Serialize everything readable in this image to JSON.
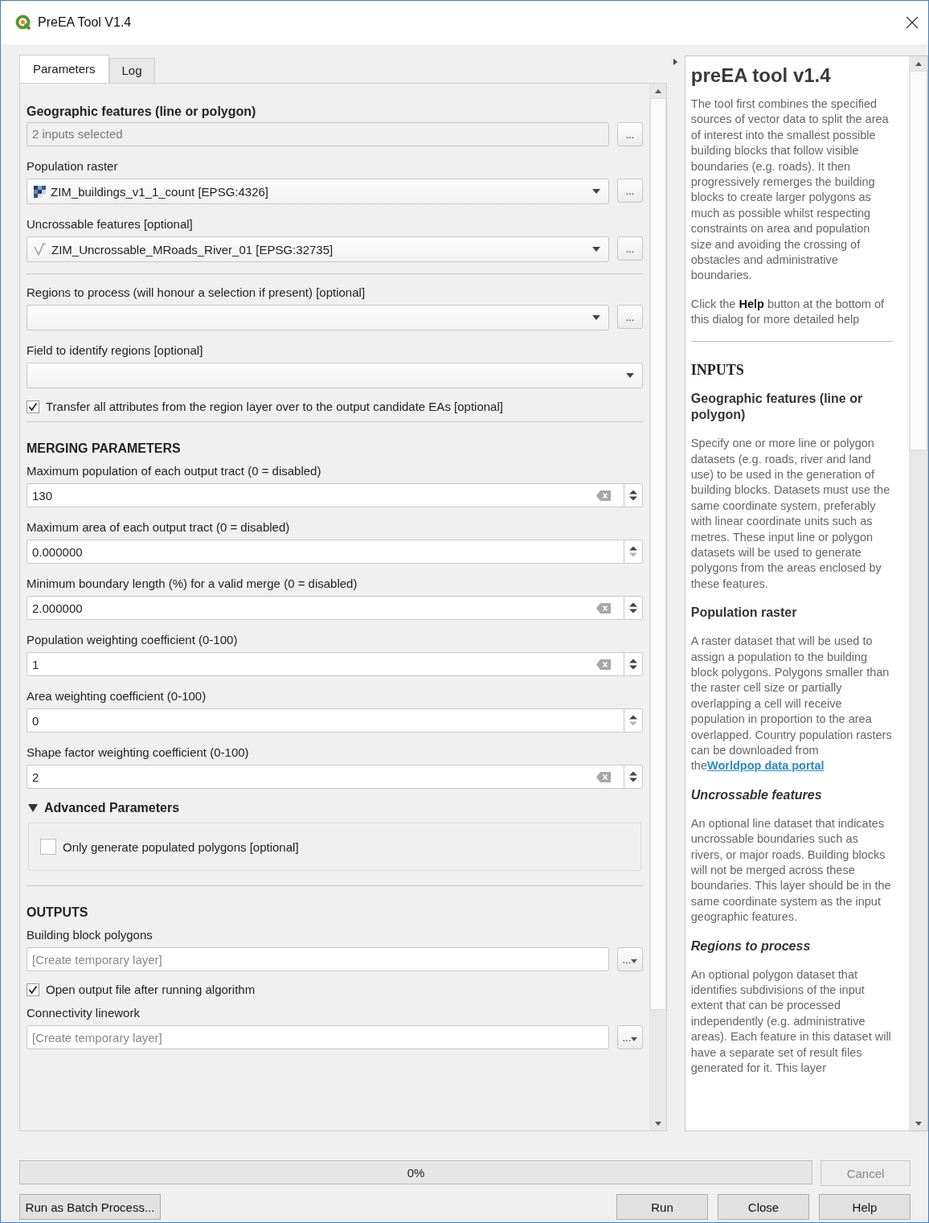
{
  "window": {
    "title": "PreEA Tool V1.4"
  },
  "tabs": [
    {
      "label": "Parameters",
      "selected": true
    },
    {
      "label": "Log",
      "selected": false
    }
  ],
  "parameters": [
    {
      "kind": "heading",
      "text": "Geographic features (line or polygon)"
    },
    {
      "kind": "multi",
      "value": "2 inputs selected",
      "button": "..."
    },
    {
      "kind": "label",
      "text": "Population raster"
    },
    {
      "kind": "raster_combo",
      "value": "ZIM_buildings_v1_1_count [EPSG:4326]",
      "button": "..."
    },
    {
      "kind": "label",
      "text": "Uncrossable features [optional]"
    },
    {
      "kind": "line_combo",
      "value": "ZIM_Uncrossable_MRoads_River_01 [EPSG:32735]",
      "button": "..."
    },
    {
      "kind": "divider"
    },
    {
      "kind": "label",
      "text": "Regions to process (will honour a selection if present) [optional]"
    },
    {
      "kind": "combo",
      "button": "..."
    },
    {
      "kind": "label",
      "text": "Field to identify regions [optional]"
    },
    {
      "kind": "combo"
    },
    {
      "kind": "checkbox",
      "text": "Transfer all attributes from the region layer over to the output candidate EAs [optional]",
      "checked": true
    },
    {
      "kind": "divider"
    },
    {
      "kind": "section",
      "text": "MERGING PARAMETERS"
    },
    {
      "kind": "label",
      "text": "Maximum population of each output tract (0 = disabled)"
    },
    {
      "kind": "spin",
      "value": "130",
      "clear": true,
      "down_enabled": true
    },
    {
      "kind": "label",
      "text": "Maximum area of each output tract (0 = disabled)"
    },
    {
      "kind": "spin",
      "value": "0.000000",
      "clear": false,
      "down_enabled": false
    },
    {
      "kind": "label",
      "text": "Minimum boundary length (%) for a valid merge (0 = disabled)"
    },
    {
      "kind": "spin",
      "value": "2.000000",
      "clear": true,
      "down_enabled": true
    },
    {
      "kind": "label",
      "text": "Population weighting coefficient (0-100)"
    },
    {
      "kind": "spin",
      "value": "1",
      "clear": true,
      "down_enabled": true
    },
    {
      "kind": "label",
      "text": "Area weighting coefficient (0-100)"
    },
    {
      "kind": "spin",
      "value": "0",
      "clear": false,
      "down_enabled": false
    },
    {
      "kind": "label",
      "text": "Shape factor weighting coefficient (0-100)"
    },
    {
      "kind": "spin",
      "value": "2",
      "clear": true,
      "down_enabled": true
    },
    {
      "kind": "group",
      "title": "Advanced Parameters",
      "expanded": true,
      "children": [
        {
          "kind": "checkbox",
          "text": "Only generate populated polygons [optional]",
          "checked": false
        }
      ]
    },
    {
      "kind": "divider"
    },
    {
      "kind": "section",
      "text": "OUTPUTS"
    },
    {
      "kind": "label",
      "text": "Building block polygons"
    },
    {
      "kind": "output",
      "placeholder": "[Create temporary layer]",
      "button": "..."
    },
    {
      "kind": "checkbox",
      "text": "Open output file after running algorithm",
      "checked": true
    },
    {
      "kind": "label",
      "text": "Connectivity linework"
    },
    {
      "kind": "output",
      "placeholder": "[Create temporary layer]",
      "button": "..."
    }
  ],
  "help": [
    {
      "kind": "title",
      "text": "preEA tool v1.4"
    },
    {
      "kind": "paragraph",
      "text": "The tool first combines the specified sources of vector data to split the area of interest into the smallest possible building blocks that follow visible boundaries (e.g. roads). It then progressively remerges the building blocks to create larger polygons as much as possible whilst respecting constraints on area and population size and avoiding the crossing of obstacles and administrative boundaries."
    },
    {
      "kind": "paragraph",
      "text": "Click the **Help** button at the bottom of this dialog for more detailed help"
    },
    {
      "kind": "divider"
    },
    {
      "kind": "section",
      "text": "INPUTS"
    },
    {
      "kind": "subheading",
      "text": "Geographic features (line or polygon)",
      "italic": false
    },
    {
      "kind": "paragraph",
      "text": "Specify one or more line or polygon datasets (e.g. roads, river and land use) to be used in the generation of building blocks. Datasets must use the same coordinate system, preferably with linear coordinate units such as metres. These input line or polygon datasets will be used to generate polygons from the areas enclosed by these features."
    },
    {
      "kind": "subheading",
      "text": "Population raster",
      "italic": false
    },
    {
      "kind": "paragraph",
      "text": "A raster dataset that will be used to assign a population to the building block polygons. Polygons smaller than the raster cell size or partially overlapping a cell will receive population in proportion to the area overlapped. Country population rasters can be downloaded from the",
      "link": "Worldpop data portal"
    },
    {
      "kind": "subheading",
      "text": "Uncrossable features",
      "italic": true
    },
    {
      "kind": "paragraph",
      "text": "An optional line dataset that indicates uncrossable boundaries such as rivers, or major roads. Building blocks will not be merged across these boundaries. This layer should be in the same coordinate system as the input geographic features."
    },
    {
      "kind": "subheading",
      "text": "Regions to process",
      "italic": true
    },
    {
      "kind": "paragraph",
      "text": "An optional polygon dataset that identifies subdivisions of the input extent that can be processed independently (e.g. administrative areas). Each feature in this dataset will have a separate set of result files generated for it. This layer"
    }
  ],
  "progress": {
    "level": 0,
    "text": "0%"
  },
  "cancel_button": {
    "label": "Cancel",
    "disabled": true
  },
  "batch_button": "Run as Batch Process...",
  "buttons": [
    "Run",
    "Close",
    "Help"
  ]
}
